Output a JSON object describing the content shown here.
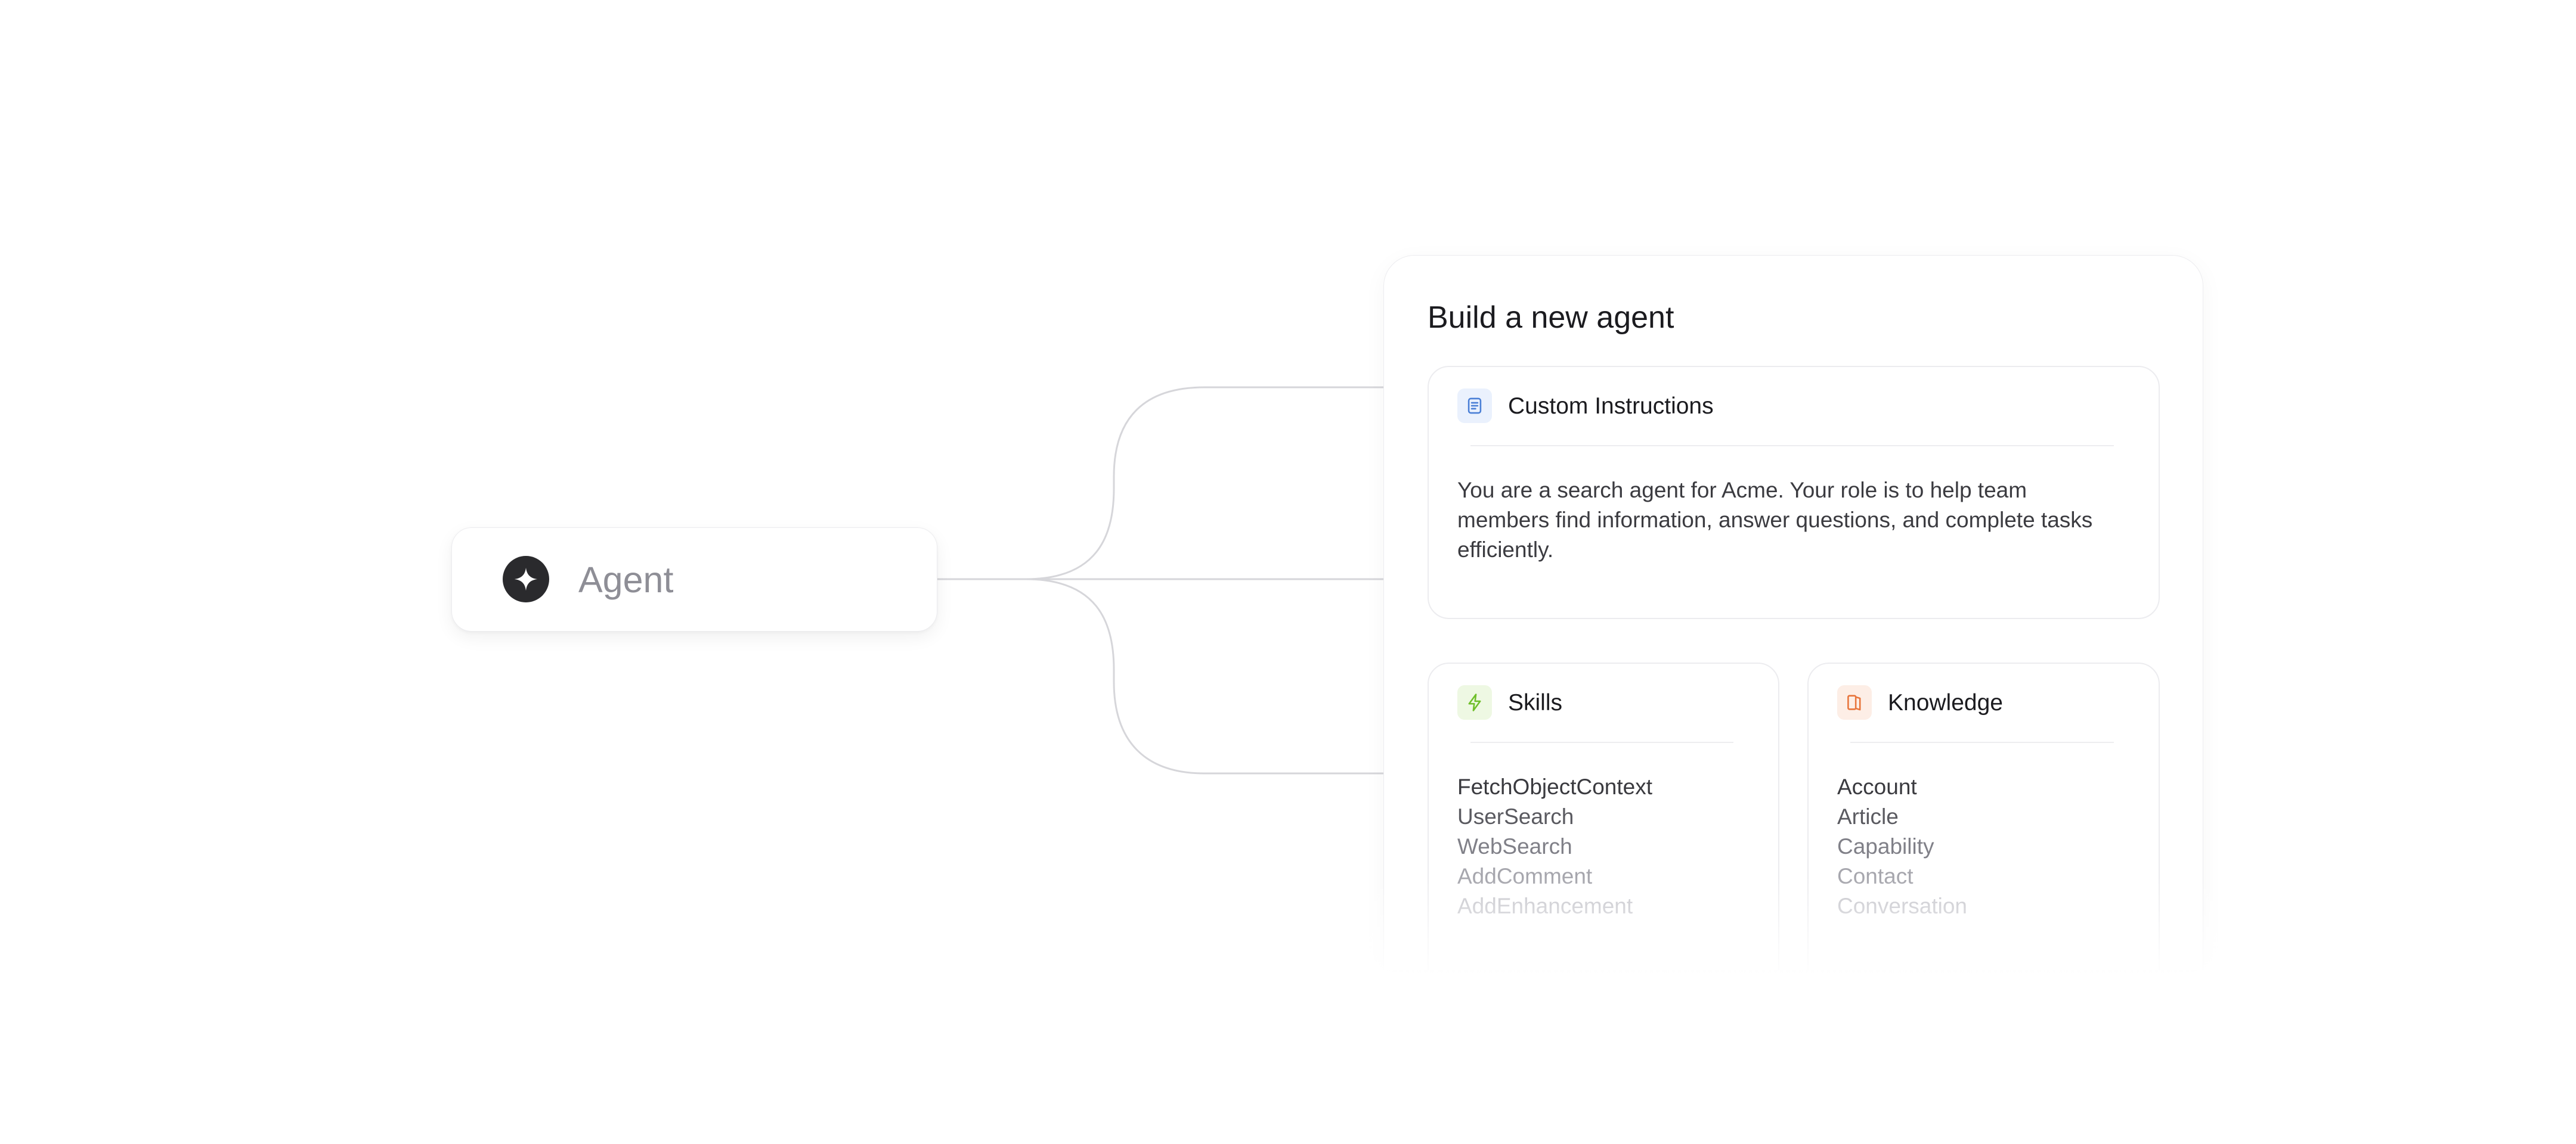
{
  "agent_node": {
    "label": "Agent",
    "icon": "sparkle-icon"
  },
  "builder": {
    "title": "Build a new agent",
    "instructions": {
      "title": "Custom Instructions",
      "icon": "document-icon",
      "text": "You are a search agent for Acme. Your role is to help team members find information, answer questions, and complete tasks efficiently."
    },
    "skills": {
      "title": "Skills",
      "icon": "lightning-icon",
      "items": [
        "FetchObjectContext",
        "UserSearch",
        "WebSearch",
        "AddComment",
        "AddEnhancement"
      ]
    },
    "knowledge": {
      "title": "Knowledge",
      "icon": "book-icon",
      "items": [
        "Account",
        "Article",
        "Capability",
        "Contact",
        "Conversation"
      ]
    }
  },
  "colors": {
    "instructions_accent": "#4a7fd6",
    "skills_accent": "#6fbf2a",
    "knowledge_accent": "#e8743b"
  }
}
